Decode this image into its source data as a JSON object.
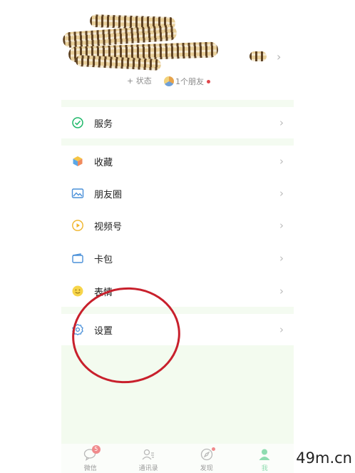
{
  "profile": {
    "status_label": "+ 状态",
    "friends_label": "1个朋友",
    "chevron": "›"
  },
  "menu": {
    "service": {
      "label": "服务",
      "icon": "service-icon"
    },
    "favorites": {
      "label": "收藏",
      "icon": "cube-icon"
    },
    "moments": {
      "label": "朋友圈",
      "icon": "image-icon"
    },
    "channels": {
      "label": "视频号",
      "icon": "play-icon"
    },
    "cards": {
      "label": "卡包",
      "icon": "card-icon"
    },
    "stickers": {
      "label": "表情",
      "icon": "smile-icon"
    },
    "settings": {
      "label": "设置",
      "icon": "gear-icon"
    },
    "chevron": "›"
  },
  "tabbar": {
    "tabs": [
      {
        "label": "微信",
        "badge": "5"
      },
      {
        "label": "通讯录"
      },
      {
        "label": "发现"
      },
      {
        "label": "我"
      }
    ]
  },
  "colors": {
    "accent_green": "#07c160",
    "annotation_red": "#c8202c"
  },
  "watermark": "49m.cn"
}
